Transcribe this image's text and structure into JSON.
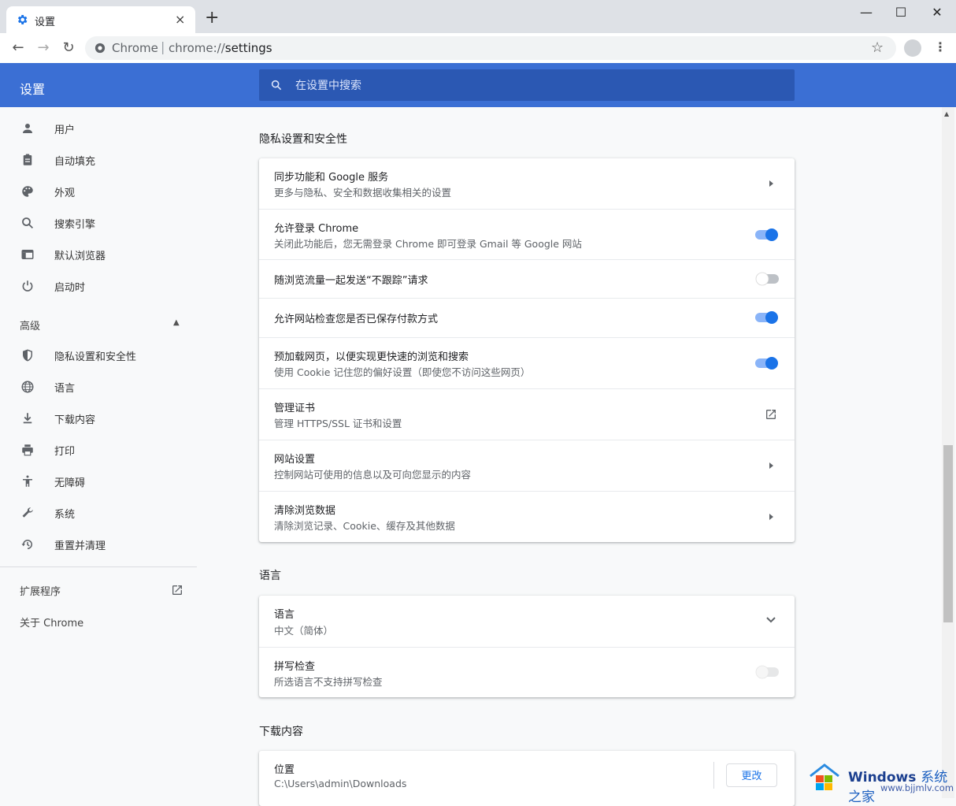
{
  "tab": {
    "title": "设置",
    "close": "×",
    "newtab": "+"
  },
  "window": {
    "minimize": "—",
    "maximize": "☐",
    "close": "✕"
  },
  "omnibox": {
    "site": "Chrome",
    "separator": "|",
    "url_prefix": "chrome://",
    "url_path": "settings"
  },
  "header": {
    "title": "设置",
    "search_placeholder": "在设置中搜索"
  },
  "sidebar": {
    "items": [
      {
        "label": "用户",
        "icon": "person-icon"
      },
      {
        "label": "自动填充",
        "icon": "clipboard-icon"
      },
      {
        "label": "外观",
        "icon": "palette-icon"
      },
      {
        "label": "搜索引擎",
        "icon": "search-icon"
      },
      {
        "label": "默认浏览器",
        "icon": "browser-icon"
      },
      {
        "label": "启动时",
        "icon": "power-icon"
      }
    ],
    "advanced_label": "高级",
    "advanced_items": [
      {
        "label": "隐私设置和安全性",
        "icon": "shield-icon"
      },
      {
        "label": "语言",
        "icon": "globe-icon"
      },
      {
        "label": "下载内容",
        "icon": "download-icon"
      },
      {
        "label": "打印",
        "icon": "printer-icon"
      },
      {
        "label": "无障碍",
        "icon": "accessibility-icon"
      },
      {
        "label": "系统",
        "icon": "wrench-icon"
      },
      {
        "label": "重置并清理",
        "icon": "history-icon"
      }
    ],
    "extensions_label": "扩展程序",
    "about_label": "关于 Chrome"
  },
  "privacy": {
    "title": "隐私设置和安全性",
    "rows": [
      {
        "title": "同步功能和 Google 服务",
        "sub": "更多与隐私、安全和数据收集相关的设置",
        "control": "arrow"
      },
      {
        "title": "允许登录 Chrome",
        "sub": "关闭此功能后，您无需登录 Chrome 即可登录 Gmail 等 Google 网站",
        "control": "toggle",
        "on": true
      },
      {
        "title": "随浏览流量一起发送“不跟踪”请求",
        "sub": "",
        "control": "toggle",
        "on": false
      },
      {
        "title": "允许网站检查您是否已保存付款方式",
        "sub": "",
        "control": "toggle",
        "on": true
      },
      {
        "title": "预加载网页，以便实现更快速的浏览和搜索",
        "sub": "使用 Cookie 记住您的偏好设置（即使您不访问这些网页）",
        "control": "toggle",
        "on": true
      },
      {
        "title": "管理证书",
        "sub": "管理 HTTPS/SSL 证书和设置",
        "control": "external"
      },
      {
        "title": "网站设置",
        "sub": "控制网站可使用的信息以及可向您显示的内容",
        "control": "arrow"
      },
      {
        "title": "清除浏览数据",
        "sub": "清除浏览记录、Cookie、缓存及其他数据",
        "control": "arrow"
      }
    ]
  },
  "language": {
    "title": "语言",
    "rows": [
      {
        "title": "语言",
        "sub": "中文（简体）",
        "control": "chevron"
      },
      {
        "title": "拼写检查",
        "sub": "所选语言不支持拼写检查",
        "control": "toggle-disabled"
      }
    ]
  },
  "downloads": {
    "title": "下载内容",
    "location_title": "位置",
    "location_path": "C:\\Users\\admin\\Downloads",
    "change_label": "更改"
  },
  "watermark": {
    "brand": "Windows",
    "brand_cn": "系统之家",
    "url": "www.bjjmlv.com"
  },
  "colors": {
    "accent": "#3b6fd4",
    "toggle_on": "#1a73e8",
    "toggle_track_on": "#8ab4f8"
  }
}
